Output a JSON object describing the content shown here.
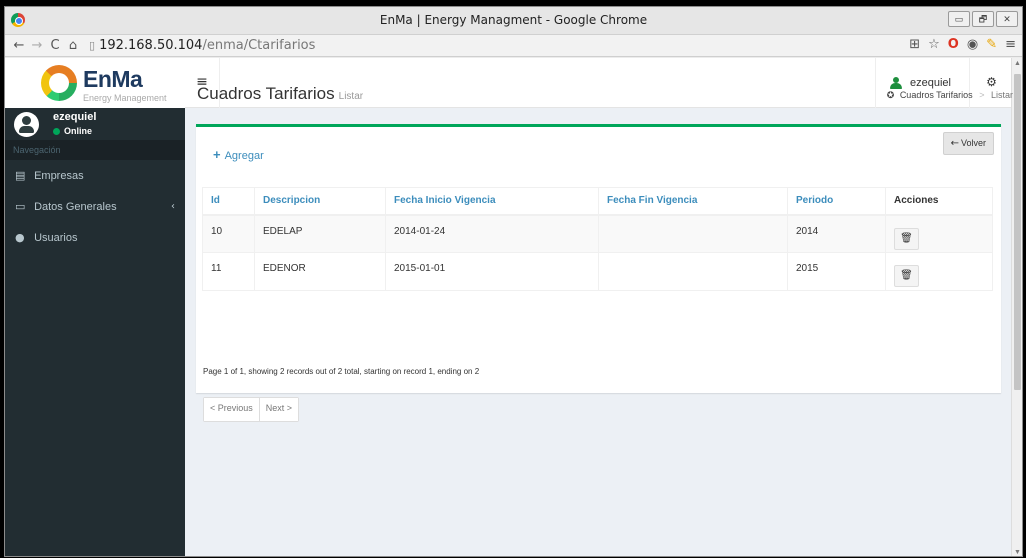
{
  "browser": {
    "window_title": "EnMa | Energy Managment - Google Chrome",
    "url_host": "192.168.50.104",
    "url_path": "/enma/Ctarifarios",
    "window_buttons": [
      "▭",
      "🗗",
      "✕"
    ]
  },
  "brand": {
    "name": "EnMa",
    "subtitle": "Energy Management"
  },
  "sidebar": {
    "user_name": "ezequiel",
    "user_status": "Online",
    "nav_header": "Navegación",
    "items": [
      {
        "label": "Empresas",
        "icon": "building-icon"
      },
      {
        "label": "Datos Generales",
        "icon": "folder-icon",
        "caret": "‹"
      },
      {
        "label": "Usuarios",
        "icon": "users-icon"
      }
    ]
  },
  "header": {
    "menu_icon": "≡",
    "user_name": "ezequiel",
    "settings_icon": "⚙"
  },
  "page": {
    "title": "Cuadros Tarifarios",
    "subtitle": "Listar",
    "breadcrumb": [
      "Cuadros Tarifarios",
      "Listar"
    ],
    "breadcrumb_sep": ">"
  },
  "toolbar": {
    "add_label": "Agregar",
    "back_label": "Volver"
  },
  "table": {
    "columns": [
      "Id",
      "Descripcion",
      "Fecha Inicio Vigencia",
      "Fecha Fin Vigencia",
      "Periodo",
      "Acciones"
    ],
    "rows": [
      {
        "id": "10",
        "descripcion": "EDELAP",
        "inicio": "2014-01-24",
        "fin": "",
        "periodo": "2014"
      },
      {
        "id": "11",
        "descripcion": "EDENOR",
        "inicio": "2015-01-01",
        "fin": "",
        "periodo": "2015"
      }
    ]
  },
  "pagination": {
    "info": "Page 1 of 1, showing 2 records out of 2 total, starting on record 1, ending on 2",
    "previous": "< Previous",
    "next": "Next >"
  },
  "colors": {
    "accent": "#3c8dbc",
    "success": "#00a65a",
    "sidebar_bg": "#222d32"
  }
}
